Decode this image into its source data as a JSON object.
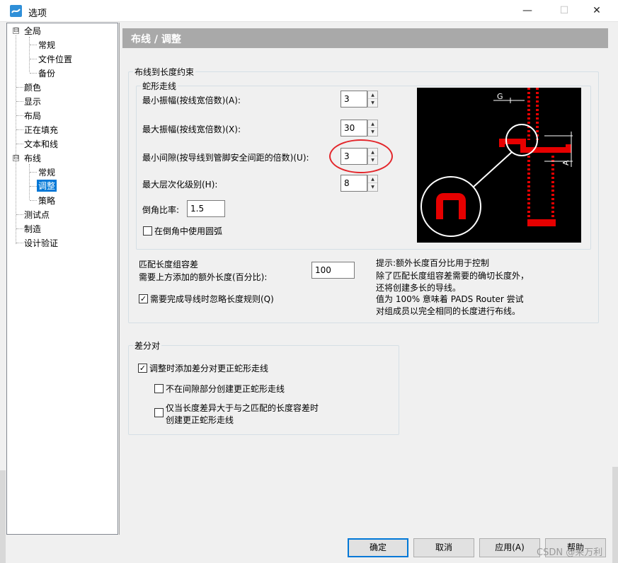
{
  "window": {
    "title": "选项",
    "min_glyph": "—",
    "max_glyph": "☐",
    "close_glyph": "✕"
  },
  "tree": {
    "items": [
      {
        "label": "全局",
        "expander": "⊟"
      },
      {
        "label": "常规"
      },
      {
        "label": "文件位置"
      },
      {
        "label": "备份"
      },
      {
        "label": "颜色"
      },
      {
        "label": "显示"
      },
      {
        "label": "布局"
      },
      {
        "label": "正在填充"
      },
      {
        "label": "文本和线"
      },
      {
        "label": "布线",
        "expander": "⊟"
      },
      {
        "label": "常规"
      },
      {
        "label": "调整",
        "selected": true
      },
      {
        "label": "策略"
      },
      {
        "label": "测试点"
      },
      {
        "label": "制造"
      },
      {
        "label": "设计验证"
      }
    ]
  },
  "header": {
    "title": "布线 / 调整"
  },
  "length_group": {
    "title": "布线到长度约束",
    "serpentine": {
      "title": "蛇形走线",
      "min_amplitude": {
        "label": "最小振幅(按线宽倍数)(A):",
        "value": "3"
      },
      "max_amplitude": {
        "label": "最大振幅(按线宽倍数)(X):",
        "value": "30"
      },
      "min_gap": {
        "label": "最小间隙(按导线到管脚安全间距的倍数)(U):",
        "value": "3"
      },
      "max_level": {
        "label": "最大层次化级别(H):",
        "value": "8"
      },
      "miter_ratio": {
        "label": "倒角比率:",
        "value": "1.5"
      },
      "use_arc": {
        "label": "在倒角中使用圆弧",
        "checked": false
      }
    },
    "diagram": {
      "g_label": "G",
      "a_label": "A"
    },
    "match_tolerance": {
      "label_line1": "匹配长度组容差",
      "label_line2": "需要上方添加的额外长度(百分比):",
      "value": "100"
    },
    "hint": {
      "line1": "提示:额外长度百分比用于控制",
      "line2": "除了匹配长度组容差需要的确切长度外，",
      "line3": "还将创建多长的导线。",
      "line4": "值为 100% 意味着 PADS Router 尝试",
      "line5": "对组成员以完全相同的长度进行布线。"
    },
    "ignore_length_rules": {
      "label": "需要完成导线时忽略长度规则(Q)",
      "checked": true
    }
  },
  "diff_pair": {
    "title": "差分对",
    "add_on_tune": {
      "label": "调整时添加差分对更正蛇形走线",
      "checked": true
    },
    "not_in_gap": {
      "label": "不在间隙部分创建更正蛇形走线",
      "checked": false
    },
    "only_when_exceeds": {
      "label_line1": "仅当长度差异大于与之匹配的长度容差时",
      "label_line2": "创建更正蛇形走线",
      "checked": false
    }
  },
  "buttons": {
    "ok": "确定",
    "cancel": "取消",
    "apply": "应用(A)",
    "help": "帮助"
  },
  "watermark": "CSDN @来万利",
  "colors": {
    "accent": "#0078d7",
    "header_bg": "#a9a9a9",
    "highlight_ring": "#e3262b",
    "trace_red": "#e60000"
  }
}
